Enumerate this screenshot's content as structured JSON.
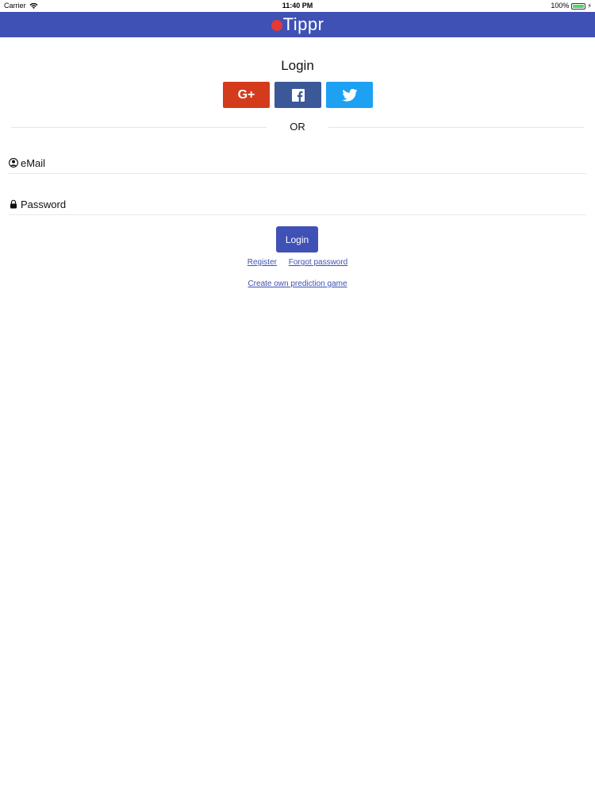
{
  "status_bar": {
    "carrier": "Carrier",
    "time": "11:40 PM",
    "battery": "100%"
  },
  "nav": {
    "logo_text": "Tippr",
    "logo_color": "#e53935",
    "bar_color": "#3f51b5"
  },
  "login": {
    "title": "Login",
    "social_buttons": [
      {
        "label": "G+",
        "icon": "google-plus-icon",
        "color": "#d33b1c"
      },
      {
        "label": "",
        "icon": "facebook-icon",
        "color": "#3b5998"
      },
      {
        "label": "",
        "icon": "twitter-icon",
        "color": "#1da1f2"
      }
    ],
    "divider_text": "OR",
    "email_placeholder": "eMail",
    "password_placeholder": "Password",
    "submit_label": "Login",
    "register_link": "Register",
    "forgot_link": "Forgot password",
    "create_game_link": "Create own prediction game"
  }
}
